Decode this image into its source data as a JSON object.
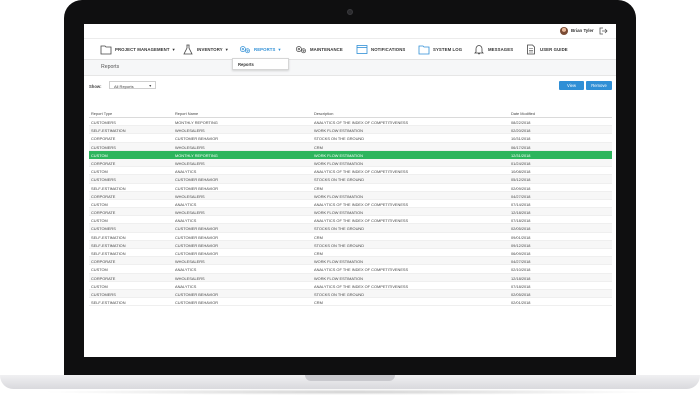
{
  "user": {
    "name": "Brian Tyler"
  },
  "nav": {
    "items": [
      {
        "label": "PROJECT MANAGEMENT",
        "caret": true,
        "icon": "folder-icon"
      },
      {
        "label": "INVENTORY",
        "caret": true,
        "icon": "flask-icon"
      },
      {
        "label": "REPORTS",
        "caret": true,
        "icon": "gears-icon",
        "active": true
      },
      {
        "label": "MAINTENANCE",
        "caret": false,
        "icon": "gears-icon"
      },
      {
        "label": "NOTIFICATIONS",
        "caret": false,
        "icon": "window-icon"
      },
      {
        "label": "SYSTEM LOG",
        "caret": false,
        "icon": "folder-icon"
      },
      {
        "label": "MESSAGES",
        "caret": false,
        "icon": "bell-icon"
      },
      {
        "label": "USER GUIDE",
        "caret": false,
        "icon": "document-icon"
      }
    ],
    "dropdown_item": "Reports",
    "accent_color": "#2f8fd6"
  },
  "page": {
    "title": "Reports"
  },
  "toolbar": {
    "show_label": "Show:",
    "show_value": "All Reports",
    "view_label": "View",
    "remove_label": "Remove"
  },
  "table": {
    "headers": [
      "Report Type",
      "Report Name",
      "Description",
      "Date Modified"
    ],
    "selected_color": "#2db55d",
    "rows": [
      [
        "CUSTOMERS",
        "MONTHLY REPORTING",
        "ANALYTICS OF THE INDEX OF COMPETITIVENESS",
        "08/22/2018"
      ],
      [
        "SELF-ESTIMATION",
        "WHOLESALERS",
        "WORK FLOW ESTIMATION",
        "02/20/2018"
      ],
      [
        "CORPORATE",
        "CUSTOMER BEHAVIOR",
        "STOCKS ON THE GROUND",
        "10/31/2018"
      ],
      [
        "CUSTOMERS",
        "WHOLESALERS",
        "CRM",
        "06/17/2018"
      ],
      [
        "CUSTOM",
        "MONTHLY REPORTING",
        "WORK FLOW ESTIMATION",
        "12/31/2018"
      ],
      [
        "CORPORATE",
        "WHOLESALERS",
        "WORK FLOW ESTIMATION",
        "01/24/2018"
      ],
      [
        "CUSTOM",
        "ANALYTICS",
        "ANALYTICS OF THE INDEX OF COMPETITIVENESS",
        "10/08/2018"
      ],
      [
        "CUSTOMERS",
        "CUSTOMER BEHAVIOR",
        "STOCKS ON THE GROUND",
        "05/12/2018"
      ],
      [
        "SELF-ESTIMATION",
        "CUSTOMER BEHAVIOR",
        "CRM",
        "02/09/2018"
      ],
      [
        "CORPORATE",
        "WHOLESALERS",
        "WORK FLOW ESTIMATION",
        "04/27/2018"
      ],
      [
        "CUSTOM",
        "ANALYTICS",
        "ANALYTICS OF THE INDEX OF COMPETITIVENESS",
        "07/14/2018"
      ],
      [
        "CORPORATE",
        "WHOLESALERS",
        "WORK FLOW ESTIMATION",
        "12/18/2018"
      ],
      [
        "CUSTOM",
        "ANALYTICS",
        "ANALYTICS OF THE INDEX OF COMPETITIVENESS",
        "07/18/2018"
      ],
      [
        "CUSTOMERS",
        "CUSTOMER BEHAVIOR",
        "STOCKS ON THE GROUND",
        "02/05/2018"
      ],
      [
        "SELF-ESTIMATION",
        "CUSTOMER BEHAVIOR",
        "CRM",
        "09/01/2018"
      ],
      [
        "SELF-ESTIMATION",
        "CUSTOMER BEHAVIOR",
        "STOCKS ON THE GROUND",
        "09/12/2018"
      ],
      [
        "SELF-ESTIMATION",
        "CUSTOMER BEHAVIOR",
        "CRM",
        "06/09/2018"
      ],
      [
        "CORPORATE",
        "WHOLESALERS",
        "WORK FLOW ESTIMATION",
        "04/27/2018"
      ],
      [
        "CUSTOM",
        "ANALYTICS",
        "ANALYTICS OF THE INDEX OF COMPETITIVENESS",
        "02/10/2018"
      ],
      [
        "CORPORATE",
        "WHOLESALERS",
        "WORK FLOW ESTIMATION",
        "12/18/2018"
      ],
      [
        "CUSTOM",
        "ANALYTICS",
        "ANALYTICS OF THE INDEX OF COMPETITIVENESS",
        "07/18/2018"
      ],
      [
        "CUSTOMERS",
        "CUSTOMER BEHAVIOR",
        "STOCKS ON THE GROUND",
        "02/05/2018"
      ],
      [
        "SELF-ESTIMATION",
        "CUSTOMER BEHAVIOR",
        "CRM",
        "02/01/2018"
      ]
    ],
    "selected_index": 4
  }
}
